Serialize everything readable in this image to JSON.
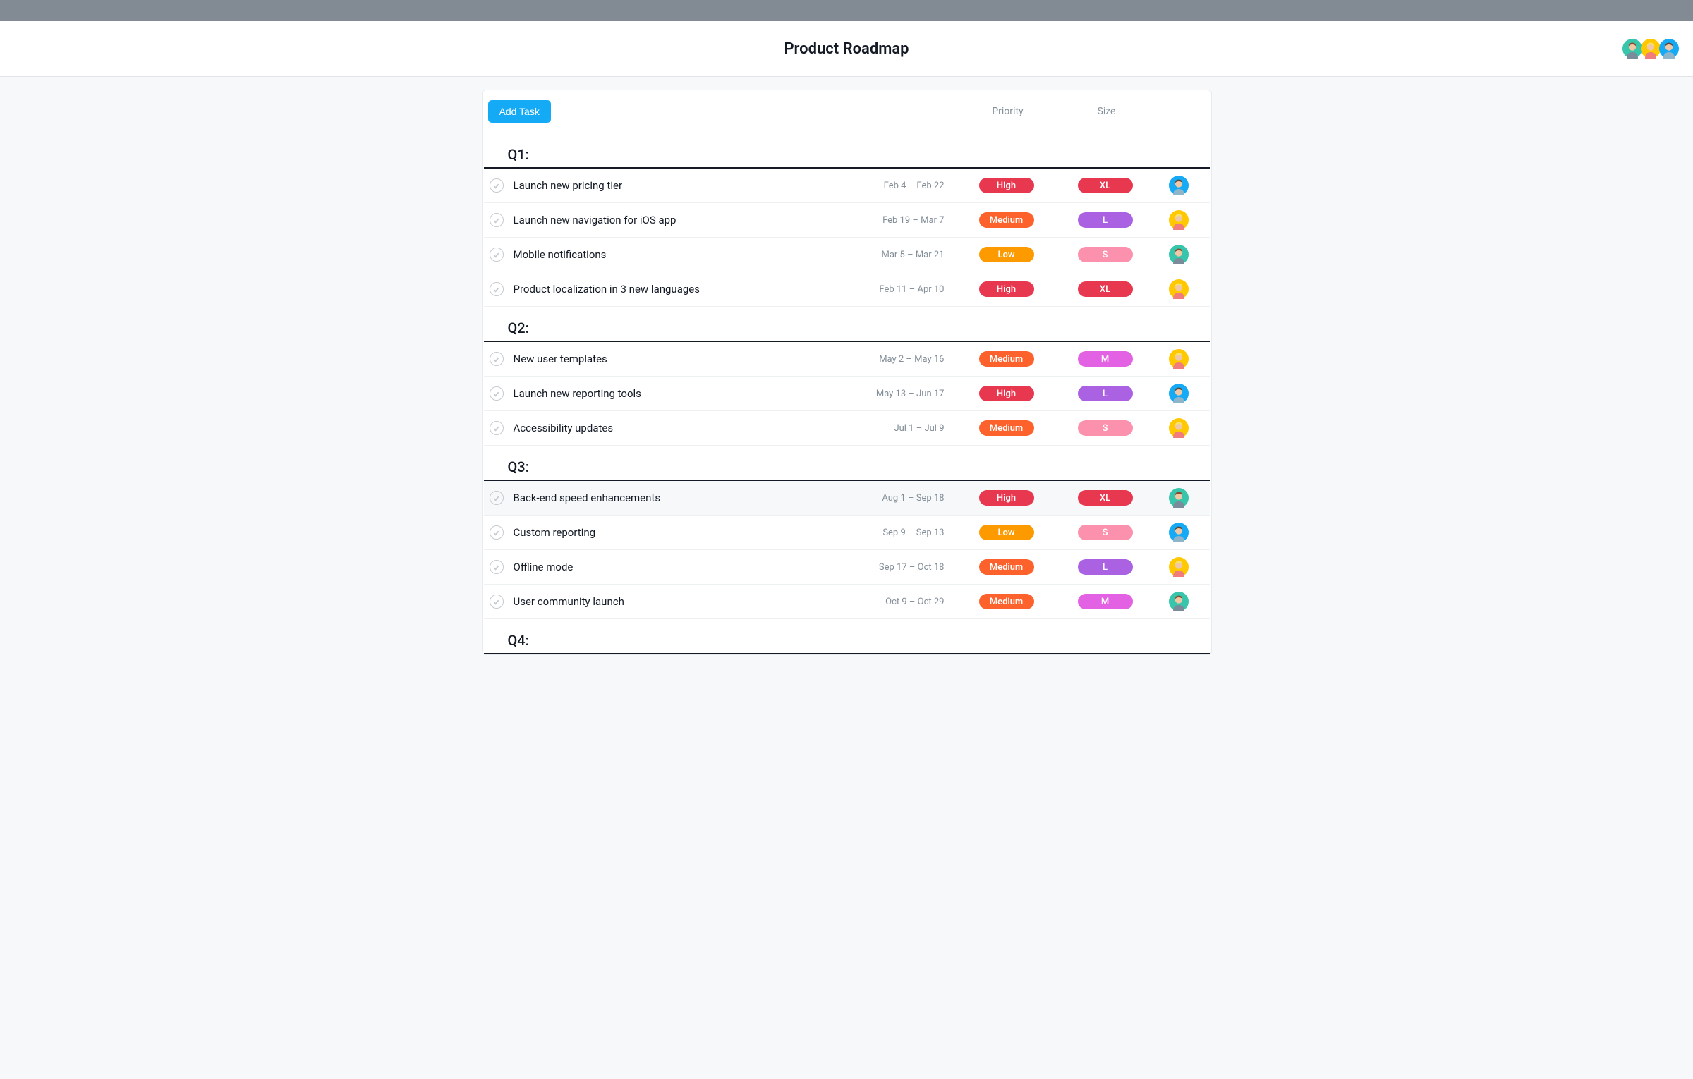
{
  "header": {
    "title": "Product Roadmap"
  },
  "toolbar": {
    "add_task_label": "Add Task",
    "columns": {
      "priority": "Priority",
      "size": "Size"
    }
  },
  "colors": {
    "high": "#e8384f",
    "medium": "#fd612c",
    "low": "#fd9a00",
    "xl": "#e8384f",
    "l": "#aa62e3",
    "m": "#e362e3",
    "s": "#fc91ad",
    "avatar_green": "#37c5ab",
    "avatar_yellow": "#ffc800",
    "avatar_blue": "#14aaf5"
  },
  "header_avatars": [
    "green",
    "yellow",
    "blue"
  ],
  "sections": [
    {
      "title": "Q1:",
      "tasks": [
        {
          "name": "Launch new pricing tier",
          "date": "Feb 4 – Feb 22",
          "priority": "High",
          "size": "XL",
          "assignee": "blue",
          "hovered": false
        },
        {
          "name": "Launch new navigation for iOS app",
          "date": "Feb 19 – Mar 7",
          "priority": "Medium",
          "size": "L",
          "assignee": "yellow",
          "hovered": false
        },
        {
          "name": "Mobile notifications",
          "date": "Mar 5 – Mar 21",
          "priority": "Low",
          "size": "S",
          "assignee": "green",
          "hovered": false
        },
        {
          "name": "Product localization in 3 new languages",
          "date": "Feb 11 – Apr 10",
          "priority": "High",
          "size": "XL",
          "assignee": "yellow",
          "hovered": false
        }
      ]
    },
    {
      "title": "Q2:",
      "tasks": [
        {
          "name": "New user templates",
          "date": "May 2 – May 16",
          "priority": "Medium",
          "size": "M",
          "assignee": "yellow",
          "hovered": false
        },
        {
          "name": "Launch new reporting tools",
          "date": "May 13 – Jun 17",
          "priority": "High",
          "size": "L",
          "assignee": "blue",
          "hovered": false
        },
        {
          "name": "Accessibility updates",
          "date": "Jul 1 – Jul 9",
          "priority": "Medium",
          "size": "S",
          "assignee": "yellow",
          "hovered": false
        }
      ]
    },
    {
      "title": "Q3:",
      "tasks": [
        {
          "name": "Back-end speed enhancements",
          "date": "Aug 1 – Sep 18",
          "priority": "High",
          "size": "XL",
          "assignee": "green",
          "hovered": true
        },
        {
          "name": "Custom reporting",
          "date": "Sep 9 – Sep 13",
          "priority": "Low",
          "size": "S",
          "assignee": "blue",
          "hovered": false
        },
        {
          "name": "Offline mode",
          "date": "Sep 17 – Oct 18",
          "priority": "Medium",
          "size": "L",
          "assignee": "yellow",
          "hovered": false
        },
        {
          "name": "User community launch",
          "date": "Oct 9 – Oct 29",
          "priority": "Medium",
          "size": "M",
          "assignee": "green",
          "hovered": false
        }
      ]
    },
    {
      "title": "Q4:",
      "tasks": []
    }
  ]
}
